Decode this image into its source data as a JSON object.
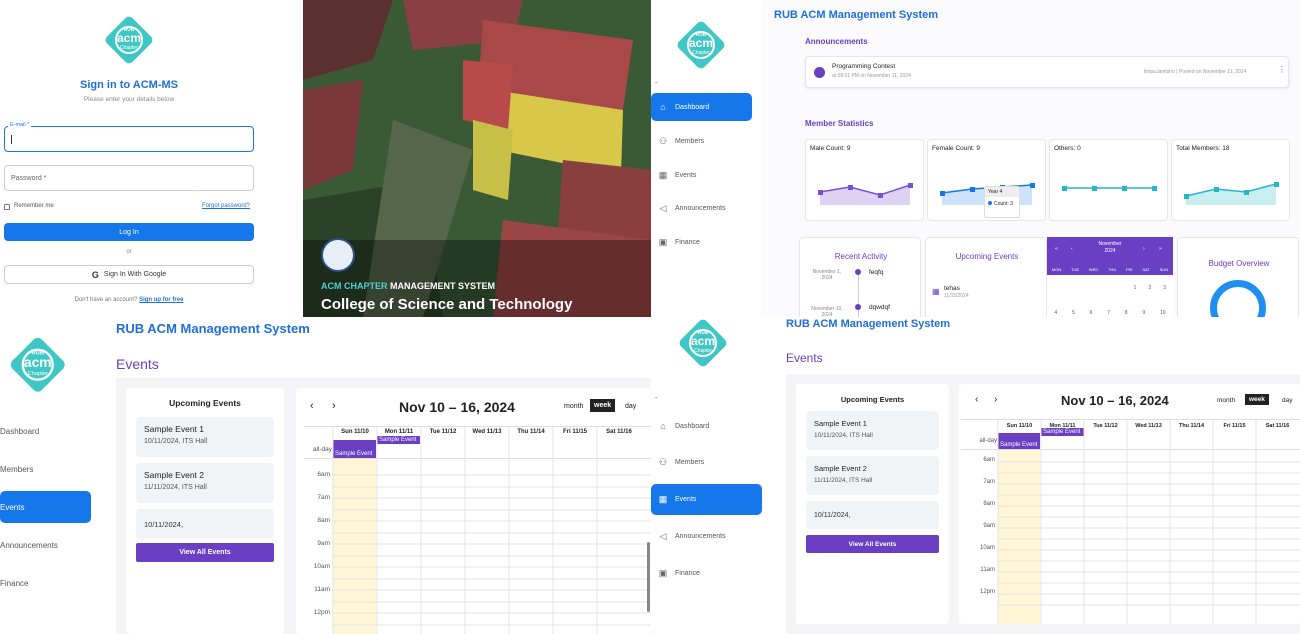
{
  "login": {
    "logo": {
      "t1": "RUB",
      "t2": "acm",
      "t3": "Chapter"
    },
    "title": "Sign in to ACM-MS",
    "subtitle": "Please enter your details below",
    "email_label": "E-mail *",
    "password_placeholder": "Password *",
    "remember": "Remember me",
    "forgot": "Forgot password?",
    "login_btn": "Log In",
    "or": "or",
    "google_btn": "Sign In With Google",
    "no_account": "Don't have an account?",
    "signup": "Sign up for free"
  },
  "hero": {
    "tag_acm": "ACM CHAPTER",
    "tag_ms": "MANAGEMENT SYSTEM",
    "college": "College of Science and Technology"
  },
  "dash": {
    "app_title": "RUB ACM Management System",
    "announcements_title": "Announcements",
    "announcement": {
      "title": "Programming Contest",
      "time": "at 08:21 PM on November 11, 2024",
      "meta": "limpa.lamtsho | Posted on November 11, 2024"
    },
    "nav": [
      "Dashboard",
      "Members",
      "Events",
      "Announcements",
      "Finance"
    ],
    "dash_minus": "-",
    "stats_title": "Member Statistics",
    "stats": [
      "Male Count: 9",
      "Female Count: 9",
      "Others: 0",
      "Total Members: 18"
    ],
    "tooltip": {
      "year": "Year 4",
      "count": "Count: 3"
    },
    "recent_title": "Recent Activity",
    "recent": [
      {
        "date": "November 1, 2024",
        "text": "feqfq"
      },
      {
        "date": "November 10, 2024",
        "text": "dqwdqf"
      }
    ],
    "upcoming_title": "Upcoming Events",
    "upcoming_item": {
      "name": "tehas",
      "date": "11/15/2024"
    },
    "mini_cal": {
      "month": "November",
      "year": "2024",
      "days": [
        "MON",
        "TUE",
        "WED",
        "THU",
        "FRI",
        "SAT",
        "SUN"
      ],
      "row1": [
        "1",
        "2",
        "3"
      ],
      "row2": [
        "4",
        "5",
        "6",
        "7",
        "8",
        "9",
        "10"
      ]
    },
    "budget_title": "Budget Overview"
  },
  "events": {
    "app_title": "RUB ACM Management System",
    "page_title": "Events",
    "nav": [
      "Dashboard",
      "Members",
      "Events",
      "Announcements",
      "Finance"
    ],
    "upcoming_title": "Upcoming Events",
    "items": [
      {
        "name": "Sample Event 1",
        "sub": "10/11/2024, ITS Hall"
      },
      {
        "name": "Sample Event 2",
        "sub": "11/11/2024, ITS Hall"
      },
      {
        "name": "",
        "sub": "10/11/2024,"
      }
    ],
    "view_all": "View All Events",
    "cal_range": "Nov 10 – 16, 2024",
    "views": [
      "month",
      "week",
      "day"
    ],
    "cols": [
      "Sun 11/10",
      "Mon 11/11",
      "Tue 11/12",
      "Wed 11/13",
      "Thu 11/14",
      "Fri 11/15",
      "Sat 11/16"
    ],
    "allday": "all-day",
    "chip": "Sample Event",
    "times": [
      "6am",
      "7am",
      "8am",
      "9am",
      "10am",
      "11am",
      "12pm"
    ]
  }
}
